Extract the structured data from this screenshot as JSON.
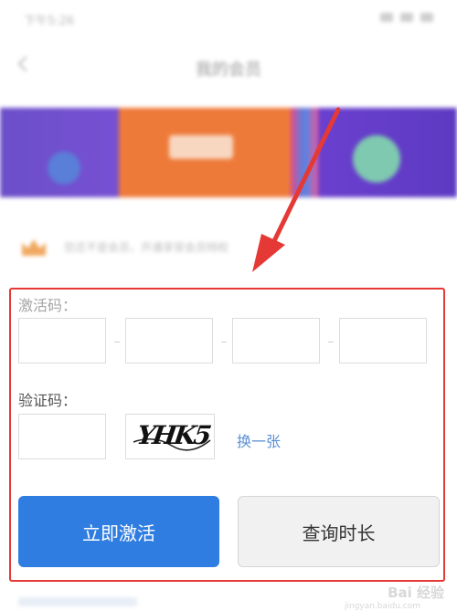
{
  "status_bar": {
    "text": "下午5:26"
  },
  "nav": {
    "title": "我的会员"
  },
  "banner": {
    "text": "活动专区"
  },
  "vip": {
    "text": "您还不是会员，开通享受会员特权"
  },
  "activation": {
    "label": "激活码：",
    "boxes": [
      "",
      "",
      "",
      ""
    ]
  },
  "verification": {
    "label": "验证码：",
    "value": "",
    "captcha_text": "YHK5",
    "refresh_label": "换一张"
  },
  "buttons": {
    "activate": "立即激活",
    "query_duration": "查询时长"
  },
  "annotation": {
    "color": "#e53935"
  },
  "watermark": {
    "brand": "Bai 经验",
    "sub": "jingyan.baidu.com"
  },
  "colors": {
    "primary": "#2f7de1",
    "link": "#5b8fd6",
    "highlight": "#e53935"
  }
}
